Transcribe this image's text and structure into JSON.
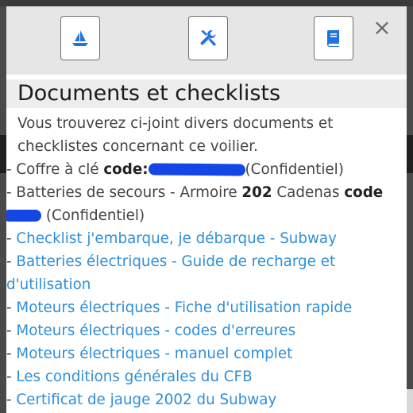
{
  "toolbar": {
    "buttons": [
      {
        "icon": "sailboat-icon"
      },
      {
        "icon": "tools-icon"
      },
      {
        "icon": "book-icon"
      }
    ],
    "close_label": "×",
    "icon_color": "#1e73e6"
  },
  "title": "Documents et checklists",
  "intro": "Vous trouverez ci-joint divers documents et checklistes concernant ce voilier.",
  "items": {
    "dash": "-",
    "coffre": {
      "text": "Coffre à clé",
      "code_label": "code:",
      "suffix": "(Confidentiel)"
    },
    "batteries_secours": {
      "text": "Batteries de secours - Armoire",
      "armoire": "202",
      "cadenas": "Cadenas",
      "code_label": "code",
      "suffix": "(Confidentiel)"
    },
    "links": [
      "Checklist j'embarque, je débarque - Subway",
      "Batteries électriques - Guide de recharge et d'utilisation",
      "Moteurs électriques - Fiche d'utilisation rapide",
      "Moteurs électriques - codes d'erreures",
      "Moteurs électriques - manuel complet",
      "Les conditions générales du CFB",
      "Certificat de jauge 2002 du Subway"
    ]
  },
  "colors": {
    "link": "#2f8fd8",
    "redaction": "#1446e6"
  }
}
